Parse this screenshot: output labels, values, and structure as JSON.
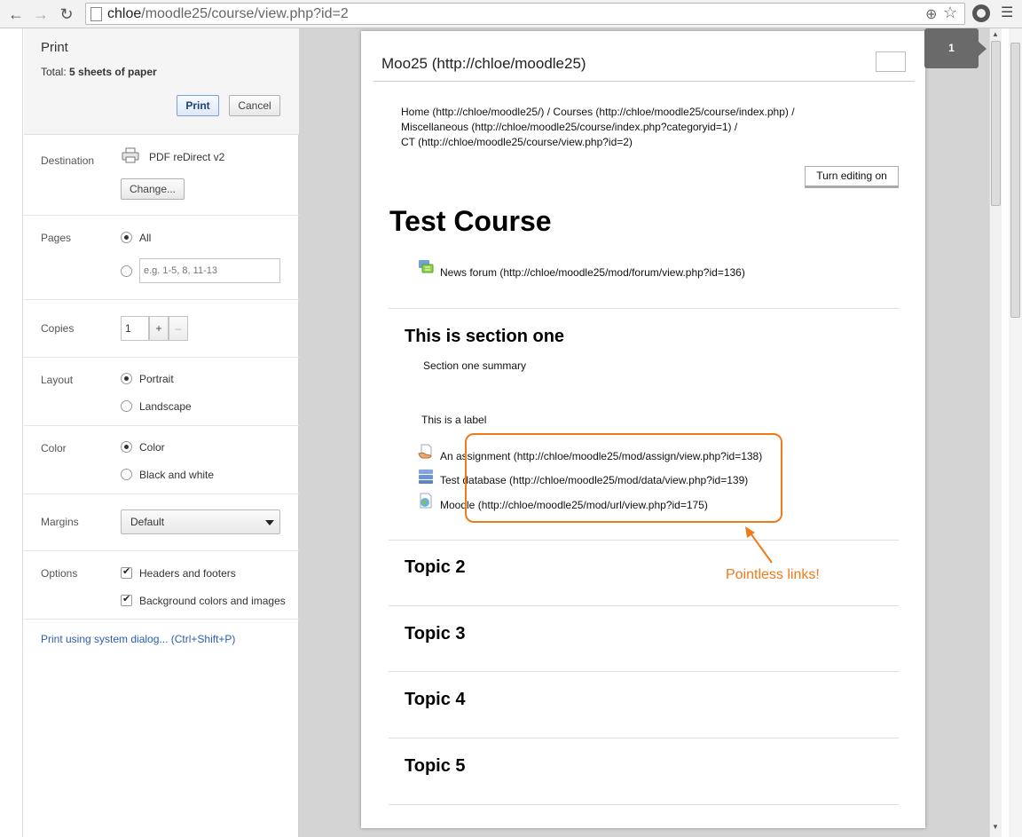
{
  "browser": {
    "url_host": "chloe",
    "url_path": "/moodle25/course/view.php?id=2"
  },
  "print_dialog": {
    "title": "Print",
    "total_label": "Total: ",
    "total_value": "5 sheets of paper",
    "print_button": "Print",
    "cancel_button": "Cancel",
    "destination": {
      "label": "Destination",
      "printer": "PDF reDirect v2",
      "change_button": "Change..."
    },
    "pages": {
      "label": "Pages",
      "all": "All",
      "range_placeholder": "e.g. 1-5, 8, 11-13"
    },
    "copies": {
      "label": "Copies",
      "value": "1",
      "plus": "+",
      "minus": "–"
    },
    "layout": {
      "label": "Layout",
      "portrait": "Portrait",
      "landscape": "Landscape"
    },
    "color": {
      "label": "Color",
      "color": "Color",
      "bw": "Black and white"
    },
    "margins": {
      "label": "Margins",
      "value": "Default"
    },
    "options": {
      "label": "Options",
      "headers_footers": "Headers and footers",
      "background": "Background colors and images"
    },
    "system_dialog_link": "Print using system dialog... (Ctrl+Shift+P)"
  },
  "preview": {
    "page_number": "1",
    "site_title": "Moo25 (http://chloe/moodle25)",
    "breadcrumb": {
      "line1": "Home (http://chloe/moodle25/)  / Courses (http://chloe/moodle25/course/index.php)  /",
      "line2": "Miscellaneous (http://chloe/moodle25/course/index.php?categoryid=1)  /",
      "line3": "CT (http://chloe/moodle25/course/view.php?id=2)"
    },
    "turn_editing_button": "Turn editing on",
    "course_title": "Test Course",
    "news_forum": "News forum (http://chloe/moodle25/mod/forum/view.php?id=136)",
    "section_one": {
      "title": "This is section one",
      "summary": "Section one summary",
      "label": "This is a label",
      "assignment": "An assignment (http://chloe/moodle25/mod/assign/view.php?id=138)",
      "database": "Test database (http://chloe/moodle25/mod/data/view.php?id=139)",
      "moodle_url": "Moodle (http://chloe/moodle25/mod/url/view.php?id=175)"
    },
    "topics": [
      "Topic 2",
      "Topic 3",
      "Topic 4",
      "Topic 5"
    ]
  },
  "annotation": {
    "text": "Pointless links!",
    "color": "#f07a1a"
  }
}
